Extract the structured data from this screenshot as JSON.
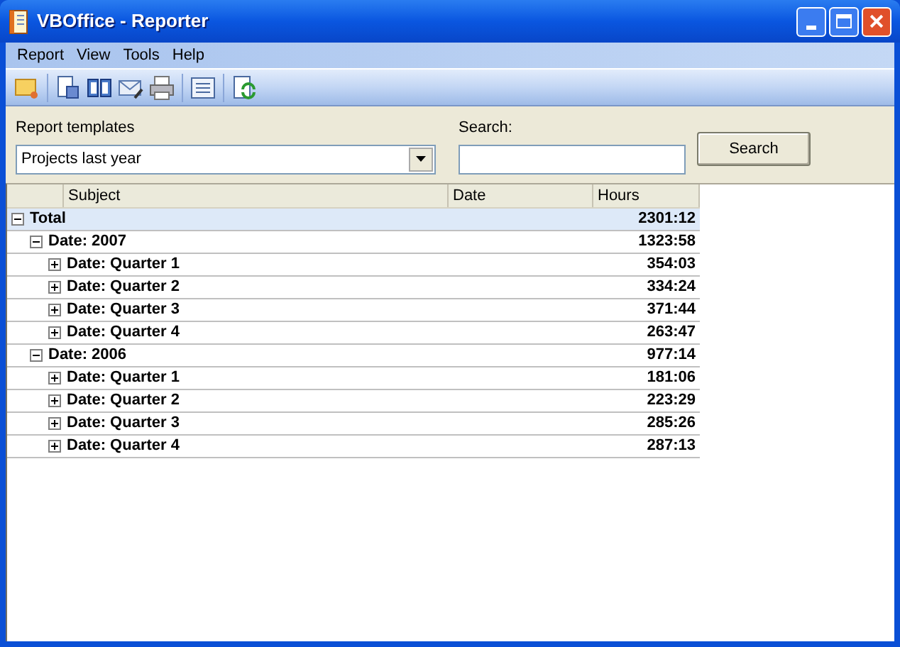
{
  "window": {
    "title": "VBOffice - Reporter"
  },
  "menu": [
    "Report",
    "View",
    "Tools",
    "Help"
  ],
  "templates": {
    "label": "Report templates",
    "value": "Projects last year"
  },
  "search": {
    "label": "Search:",
    "button": "Search"
  },
  "table": {
    "columns": [
      "Subject",
      "Date",
      "Hours"
    ],
    "rows": [
      {
        "subject": "Total",
        "hours": "2301:12",
        "expanded": true,
        "selected": true,
        "children": [
          {
            "subject": "Date: 2007",
            "hours": "1323:58",
            "expanded": true,
            "selected": false,
            "children": [
              {
                "subject": "Date: Quarter 1",
                "hours": "354:03",
                "expanded": false,
                "selected": false
              },
              {
                "subject": "Date: Quarter 2",
                "hours": "334:24",
                "expanded": false,
                "selected": false
              },
              {
                "subject": "Date: Quarter 3",
                "hours": "371:44",
                "expanded": false,
                "selected": false
              },
              {
                "subject": "Date: Quarter 4",
                "hours": "263:47",
                "expanded": false,
                "selected": false
              }
            ]
          },
          {
            "subject": "Date: 2006",
            "hours": "977:14",
            "expanded": true,
            "selected": false,
            "children": [
              {
                "subject": "Date: Quarter 1",
                "hours": "181:06",
                "expanded": false,
                "selected": false
              },
              {
                "subject": "Date: Quarter 2",
                "hours": "223:29",
                "expanded": false,
                "selected": false
              },
              {
                "subject": "Date: Quarter 3",
                "hours": "285:26",
                "expanded": false,
                "selected": false
              },
              {
                "subject": "Date: Quarter 4",
                "hours": "287:13",
                "expanded": false,
                "selected": false
              }
            ]
          }
        ]
      }
    ]
  }
}
